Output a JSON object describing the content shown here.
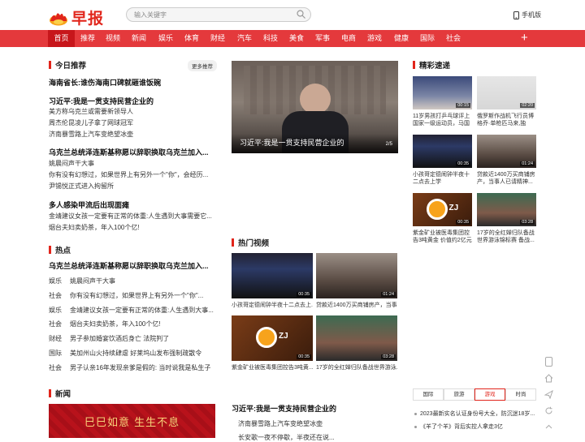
{
  "brand": {
    "name": "早报",
    "accent": "#e1251b",
    "nav_bg": "#e4393c"
  },
  "search": {
    "placeholder": "输入关键字"
  },
  "mobile": {
    "label": "手机版"
  },
  "nav": [
    "首页",
    "推荐",
    "视频",
    "新闻",
    "娱乐",
    "体育",
    "财经",
    "汽车",
    "科技",
    "美食",
    "军事",
    "电商",
    "游戏",
    "健康",
    "国际",
    "社会"
  ],
  "today": {
    "title": "今日推荐",
    "more": "更多推荐",
    "items": [
      {
        "text": "海南省长:谁伤海南口碑就砸谁饭碗",
        "bold": true
      },
      {
        "text": "习近平:我是一贯支持民营企业的",
        "bold": true
      },
      {
        "text": "美方称乌克兰或需要新领导人",
        "bold": false
      },
      {
        "text": "周杰伦昆凌儿子拿了网球冠军",
        "bold": false
      },
      {
        "text": "济南暴雪路上汽车变绝望冰壶",
        "bold": false
      },
      {
        "text": "乌克兰总统泽连斯基称愿以辞职换取乌克兰加入...",
        "bold": true
      },
      {
        "text": "姚晨闷声干大事",
        "bold": false
      },
      {
        "text": "你有没有幻想过，如果世界上有另外一个\"你\"，会经历...",
        "bold": false
      },
      {
        "text": "尹锡悦正式进入拘留所",
        "bold": false
      },
      {
        "text": "多人感染甲流后出现面瘫",
        "bold": true
      },
      {
        "text": "金靖建议女孩一定要有正常的体重:人生遇到大事需要它...",
        "bold": false
      },
      {
        "text": "烟台夫妇卖奶茶，年入100个亿!",
        "bold": false
      }
    ]
  },
  "hot": {
    "title": "热点",
    "lead": "乌克兰总统泽连斯基称愿以辞职换取乌克兰加入...",
    "items": [
      {
        "cat": "娱乐",
        "text": "姚晨闷声干大事"
      },
      {
        "cat": "社会",
        "text": "你有没有幻想过，如果世界上有另外一个\"你\"..."
      },
      {
        "cat": "娱乐",
        "text": "金靖建议女孩一定要有正常的体重:人生遇到大事..."
      },
      {
        "cat": "社会",
        "text": "烟台夫妇卖奶茶，年入100个亿!"
      },
      {
        "cat": "财经",
        "text": "男子参加婚宴饮酒后身亡 法院判了"
      },
      {
        "cat": "国际",
        "text": "美加州山火持续肆虐 好莱坞山发布强制疏散令"
      },
      {
        "cat": "社会",
        "text": "男子认亲16年发现亲爹是假的: 当时说我是私生子"
      }
    ]
  },
  "news": {
    "title": "新闻",
    "banner_text": "巳巳如意 生生不息"
  },
  "hero": {
    "caption": "习近平:我是一贯支持民营企业的",
    "page": "2/5"
  },
  "hot_video": {
    "title": "热门视频",
    "items": [
      {
        "dur": "00:35",
        "cap": "小孩哥定德闹钟半夜十二点去上..."
      },
      {
        "dur": "01:24",
        "cap": "贷款近1400万买商铺房产，当事..."
      },
      {
        "dur": "00:35",
        "cap": "紫金矿业被医毒集团控告3吨黄..."
      },
      {
        "dur": "03:28",
        "cap": "17岁的全红婵归队备战世界游泳..."
      }
    ]
  },
  "center_list": {
    "items": [
      {
        "text": "习近平:我是一贯支持民营企业的",
        "bold": true
      },
      {
        "text": "济南暴雪路上汽车变绝望冰壶",
        "bold": false
      },
      {
        "text": "长安歌一夜不停歇，半夜还在说...",
        "bold": false
      }
    ]
  },
  "highlights": {
    "title": "精彩速递",
    "items": [
      {
        "dur": "00:15",
        "cap": "11岁男孩打乒乓球评上国家一级运动员，马国栋..."
      },
      {
        "dur": "02:20",
        "cap": "俄罗斯作战机飞行员博格乔·单枪匹马来,独自..."
      },
      {
        "dur": "00:35",
        "cap": "小孩哥定德闹钟半夜十二点去上学"
      },
      {
        "dur": "01:24",
        "cap": "贷款近1400万买商铺房产，当事人已请精神..."
      },
      {
        "dur": "00:35",
        "cap": "紫金矿业被医毒集团控告3吨黄金 价值约2亿元"
      },
      {
        "dur": "03:28",
        "cap": "17岁的全红婵归队备战世界游泳锦标赛 备战..."
      }
    ]
  },
  "side_tabs": {
    "tabs": [
      "国际",
      "旅游",
      "游戏",
      "时尚"
    ],
    "active": 2,
    "items": [
      "2023最新实名认证身份号大全，防沉迷18岁...",
      "《羊了个羊》背后实控人拿走3亿"
    ]
  }
}
